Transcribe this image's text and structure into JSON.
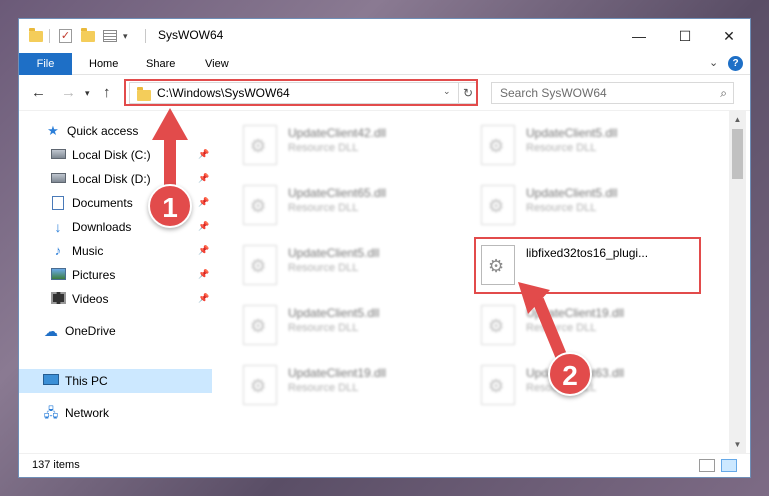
{
  "window": {
    "title": "SysWOW64",
    "minimize": "—",
    "maximize": "☐",
    "close": "✕"
  },
  "ribbon": {
    "file": "File",
    "home": "Home",
    "share": "Share",
    "view": "View"
  },
  "address": {
    "path": "C:\\Windows\\SysWOW64",
    "search_placeholder": "Search SysWOW64"
  },
  "nav": {
    "quick_access": "Quick access",
    "local_c": "Local Disk (C:)",
    "local_d": "Local Disk (D:)",
    "documents": "Documents",
    "downloads": "Downloads",
    "music": "Music",
    "pictures": "Pictures",
    "videos": "Videos",
    "onedrive": "OneDrive",
    "this_pc": "This PC",
    "network": "Network"
  },
  "files": [
    {
      "name": "UpdateClient42.dll",
      "type": "Resource DLL"
    },
    {
      "name": "UpdateClient5.dll",
      "type": "Resource DLL"
    },
    {
      "name": "UpdateClient65.dll",
      "type": "Resource DLL"
    },
    {
      "name": "UpdateClient5.dll",
      "type": "Resource DLL"
    },
    {
      "name": "UpdateClient5.dll",
      "type": "Resource DLL"
    },
    {
      "name": "libfixed32tos16_plugi...",
      "type": ""
    },
    {
      "name": "UpdateClient5.dll",
      "type": "Resource DLL"
    },
    {
      "name": "UpdateClient19.dll",
      "type": "Resource DLL"
    },
    {
      "name": "UpdateClient19.dll",
      "type": "Resource DLL"
    },
    {
      "name": "UpdateClient63.dll",
      "type": "Resource DLL"
    }
  ],
  "status": {
    "items": "137 items"
  },
  "annotations": {
    "step1": "1",
    "step2": "2"
  },
  "colors": {
    "accent": "#1e6fc6",
    "highlight": "#e24b4b",
    "selected": "#cce8ff"
  }
}
